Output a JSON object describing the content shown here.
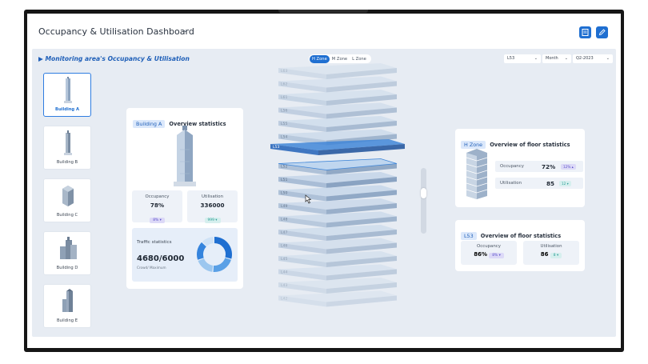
{
  "header": {
    "title": "Occupancy & Utilisation Dashboard"
  },
  "area": {
    "title": "Monitoring area's Occupancy & Utilisation"
  },
  "zones": [
    {
      "label": "H Zone",
      "active": true
    },
    {
      "label": "M Zone",
      "active": false
    },
    {
      "label": "L Zone",
      "active": false
    }
  ],
  "filters": {
    "floor": "L53",
    "period": "Month",
    "quarter": "Q2-2023"
  },
  "buildings": [
    {
      "label": "Building A",
      "active": true
    },
    {
      "label": "Building B",
      "active": false
    },
    {
      "label": "Building C",
      "active": false
    },
    {
      "label": "Building D",
      "active": false
    },
    {
      "label": "Building E",
      "active": false
    }
  ],
  "overview": {
    "tag": "Building A",
    "title": "Overview statistics",
    "occupancy": {
      "label": "Occupancy",
      "value": "78%",
      "change": "8%"
    },
    "utilisation": {
      "label": "Utilisation",
      "value": "336000",
      "change": "999"
    },
    "traffic": {
      "title": "Traffic statistics",
      "value": "4680/6000",
      "subtitle": "Crowd/ Maximum",
      "segments": [
        0.3,
        0.22,
        0.18,
        0.18,
        0.12
      ]
    }
  },
  "floors": [
    "L63",
    "L62",
    "L61",
    "L56",
    "L55",
    "L54",
    "L53",
    "L52",
    "L51",
    "L50",
    "L49",
    "L48",
    "L47",
    "L46",
    "L45",
    "L44",
    "L43",
    "L42"
  ],
  "selected_floor": "L53",
  "hovered_floor": "L52",
  "zone_stats": {
    "tag": "H Zone",
    "title": "Overview of floor statistics",
    "occupancy": {
      "label": "Occupancy",
      "value": "72%",
      "change": "12%",
      "direction": "up"
    },
    "utilisation": {
      "label": "Utilisation",
      "value": "85",
      "change": "12",
      "direction": "down"
    }
  },
  "floor_stats": {
    "tag": "L53",
    "title": "Overview of floor statistics",
    "occupancy": {
      "label": "Occupancy",
      "value": "86%",
      "change": "8%"
    },
    "utilisation": {
      "label": "Utilisation",
      "value": "86",
      "change": "8"
    }
  },
  "colors": {
    "accent": "#1f6fd1",
    "purple": "#5b50c9",
    "teal": "#2c9d96",
    "background": "#e7ecf3"
  }
}
